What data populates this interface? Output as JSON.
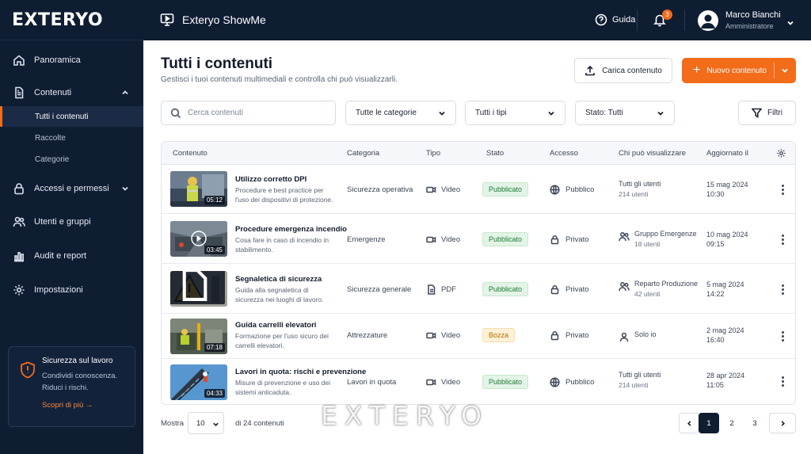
{
  "brand": {
    "logo_text": "EXTERYO",
    "app_title": "Exteryo ShowMe",
    "accent": "#f26c1a",
    "navy": "#0f1d33"
  },
  "topbar": {
    "help_label": "Guida",
    "notifications_count": "3",
    "user_name": "Marco Bianchi",
    "user_role": "Amministratore"
  },
  "sidebar": {
    "items": [
      {
        "label": "Panoramica",
        "icon": "home-icon"
      },
      {
        "label": "Contenuti",
        "icon": "document-icon"
      },
      {
        "label": "Accessi e permessi",
        "icon": "lock-icon"
      },
      {
        "label": "Utenti e gruppi",
        "icon": "users-icon"
      },
      {
        "label": "Audit e report",
        "icon": "bar-chart-icon"
      },
      {
        "label": "Impostazioni",
        "icon": "gear-icon"
      }
    ],
    "sub_items": [
      {
        "label": "Tutti i contenuti",
        "active": true
      },
      {
        "label": "Raccolte"
      },
      {
        "label": "Categorie"
      }
    ],
    "promo": {
      "title": "Sicurezza sul lavoro",
      "line1": "Condividi conoscenza.",
      "line2": "Riduci i rischi.",
      "link": "Scopri di più →"
    }
  },
  "main": {
    "title": "Tutti i contenuti",
    "subtitle": "Gestisci i tuoi contenuti multimediali e controlla chi può visualizzarli.",
    "upload_label": "Carica contenuto",
    "new_label": "Nuovo contenuto"
  },
  "filters": {
    "search_placeholder": "Cerca contenuti",
    "category": "Tutte le categorie",
    "type": "Tutti i tipi",
    "status": "Stato: Tutti",
    "filters_label": "Filtri"
  },
  "table": {
    "columns": [
      "Contenuto",
      "Categoria",
      "Tipo",
      "Stato",
      "Accesso",
      "Chi può visualizzare",
      "Aggiornato il"
    ],
    "rows": [
      {
        "title": "Utilizzo corretto DPI",
        "desc": "Procedure e best practice per l'uso dei dispositivi di protezione.",
        "duration": "05:12",
        "category": "Sicurezza operativa",
        "type": "Video",
        "status": "Pubblicato",
        "access": "Pubblico",
        "viewers": "Tutti gli utenti",
        "viewers_count": "214 utenti",
        "date": "15 mag 2024",
        "time": "10:30"
      },
      {
        "title": "Procedure emergenza incendio",
        "desc": "Cosa fare in caso di incendio in stabilimento.",
        "duration": "03:45",
        "category": "Emergenze",
        "type": "Video",
        "status": "Pubblicato",
        "access": "Privato",
        "viewers": "Gruppo Emergenze",
        "viewers_count": "18 utenti",
        "date": "10 mag 2024",
        "time": "09:15"
      },
      {
        "title": "Segnaletica di sicurezza",
        "desc": "Guida alla segnaletica di sicurezza nei luoghi di lavoro.",
        "duration": "",
        "category": "Sicurezza generale",
        "type": "PDF",
        "status": "Pubblicato",
        "access": "Privato",
        "viewers": "Reparto Produzione",
        "viewers_count": "42 utenti",
        "date": "5 mag 2024",
        "time": "14:22"
      },
      {
        "title": "Guida carrelli elevatori",
        "desc": "Formazione per l'uso sicuro dei carrelli elevatori.",
        "duration": "07:18",
        "category": "Attrezzature",
        "type": "Video",
        "status": "Bozza",
        "access": "Privato",
        "viewers": "Solo io",
        "viewers_count": "",
        "date": "2 mag 2024",
        "time": "16:40"
      },
      {
        "title": "Lavori in quota: rischi e prevenzione",
        "desc": "Misure di prevenzione e uso dei sistemi anticaduta.",
        "duration": "04:33",
        "category": "Lavori in quota",
        "type": "Video",
        "status": "Pubblicato",
        "access": "Pubblico",
        "viewers": "Tutti gli utenti",
        "viewers_count": "214 utenti",
        "date": "28 apr 2024",
        "time": "11:05"
      }
    ]
  },
  "footer": {
    "show_label": "Mostra",
    "per_page": "10",
    "total": "di 24 contenuti",
    "pages": [
      "1",
      "2",
      "3"
    ],
    "watermark": "EXTERYO"
  }
}
